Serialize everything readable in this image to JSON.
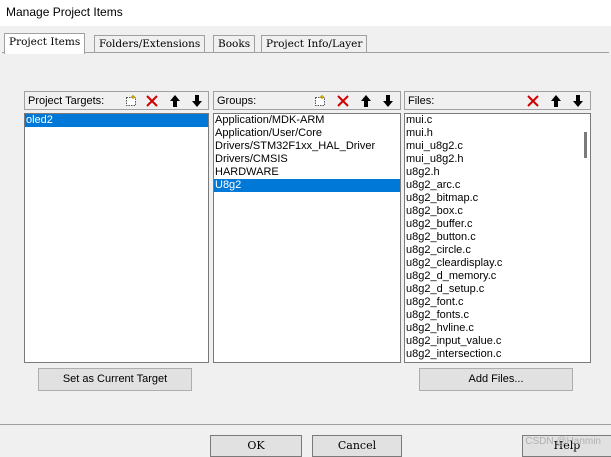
{
  "window": {
    "title": "Manage Project Items"
  },
  "tabs": [
    {
      "label": "Project Items",
      "active": true
    },
    {
      "label": "Folders/Extensions",
      "active": false
    },
    {
      "label": "Books",
      "active": false
    },
    {
      "label": "Project Info/Layer",
      "active": false
    }
  ],
  "targets": {
    "header": "Project Targets:",
    "items": [
      "oled2"
    ],
    "selected_index": 0
  },
  "groups": {
    "header": "Groups:",
    "items": [
      "Application/MDK-ARM",
      "Application/User/Core",
      "Drivers/STM32F1xx_HAL_Driver",
      "Drivers/CMSIS",
      "HARDWARE",
      "U8g2"
    ],
    "selected_index": 5
  },
  "files": {
    "header": "Files:",
    "items": [
      "mui.c",
      "mui.h",
      "mui_u8g2.c",
      "mui_u8g2.h",
      "u8g2.h",
      "u8g2_arc.c",
      "u8g2_bitmap.c",
      "u8g2_box.c",
      "u8g2_buffer.c",
      "u8g2_button.c",
      "u8g2_circle.c",
      "u8g2_cleardisplay.c",
      "u8g2_d_memory.c",
      "u8g2_d_setup.c",
      "u8g2_font.c",
      "u8g2_fonts.c",
      "u8g2_hvline.c",
      "u8g2_input_value.c",
      "u8g2_intersection.c"
    ]
  },
  "buttons": {
    "set_target": "Set as Current Target",
    "add_files": "Add Files...",
    "ok": "OK",
    "cancel": "Cancel",
    "help": "Help"
  },
  "watermark": "CSDN @Hanmin",
  "colors": {
    "selection": "#0078d7",
    "delete_red": "#d00000"
  },
  "icons": [
    "new-item-icon",
    "delete-icon",
    "move-up-icon",
    "move-down-icon"
  ]
}
